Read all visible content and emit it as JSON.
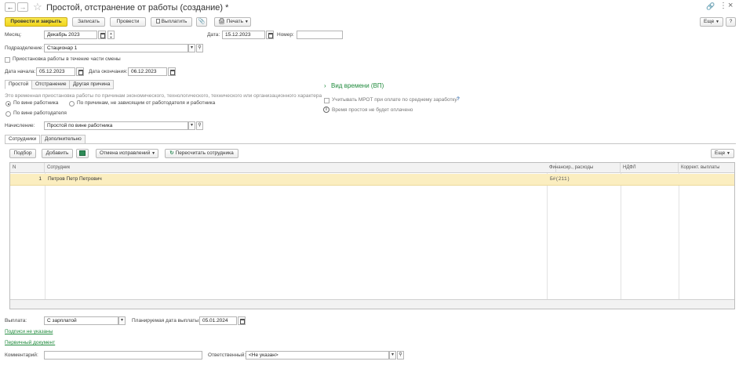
{
  "window": {
    "title": "Простой, отстранение от работы (создание) *",
    "more_label": "Еще"
  },
  "toolbar": {
    "post_close": "Провести и закрыть",
    "save": "Записать",
    "post": "Провести",
    "pay": "Выплатить",
    "print": "Печать"
  },
  "header": {
    "month_label": "Месяц:",
    "month_value": "Декабрь 2023",
    "date_label": "Дата:",
    "date_value": "15.12.2023",
    "number_label": "Номер:",
    "number_value": "",
    "dept_label": "Подразделение:",
    "dept_value": "Стационар 1",
    "partial_shift_label": "Приостановка работы в течение части смены",
    "start_label": "Дата начала:",
    "start_value": "05.12.2023",
    "end_label": "Дата окончания:",
    "end_value": "06.12.2023"
  },
  "reason_tabs": [
    "Простой",
    "Отстранение",
    "Другая причина"
  ],
  "reason_desc": "Это временная приостановка работы по причинам экономического, технологического, технического или организационного характера",
  "reason_options": [
    "По вине работника",
    "По причинам, не зависящим от работодателя и работника",
    "По вине работодателя"
  ],
  "time_type": {
    "label": "Вид времени (ВП)",
    "mrot_label": "Учитывать МРОТ при оплате по среднему заработку",
    "help": "?",
    "info": "Время простоя не будет оплачено"
  },
  "accrual": {
    "label": "Начисление:",
    "value": "Простой по вине работника"
  },
  "tabs": [
    "Сотрудники",
    "Дополнительно"
  ],
  "table_toolbar": {
    "select": "Подбор",
    "add": "Добавить",
    "cancel_fix": "Отмена исправлений",
    "recalc": "Пересчитать сотрудника",
    "more": "Еще"
  },
  "table": {
    "headers": [
      "N",
      "Сотрудник",
      "Финансир., расходы",
      "НДФЛ",
      "Коррект. выплаты"
    ],
    "rows": [
      {
        "n": "1",
        "employee": "Петров Петр Петрович",
        "finance": "Б#(211)",
        "ndfl": "",
        "correction": ""
      }
    ]
  },
  "footer": {
    "payout_label": "Выплата:",
    "payout_value": "С зарплатой",
    "planned_label": "Планируемая дата выплаты:",
    "planned_value": "05.01.2024",
    "signatures": "Подписи не указаны",
    "primary_doc": "Первичный документ",
    "comment_label": "Комментарий:",
    "comment_value": "",
    "responsible_label": "Ответственный:",
    "responsible_value": "<Не указан>"
  }
}
